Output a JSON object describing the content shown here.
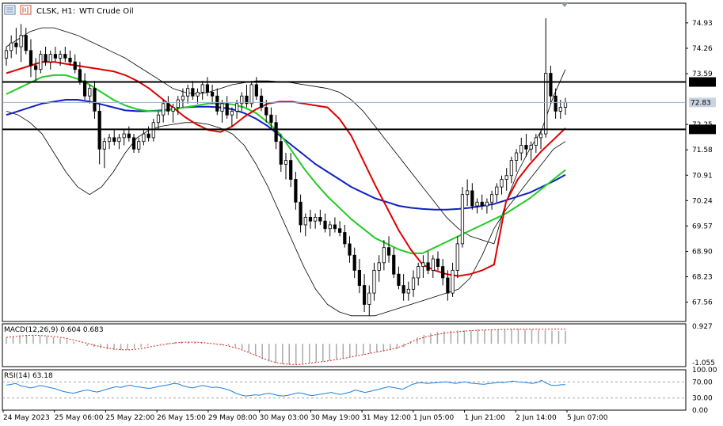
{
  "header": {
    "symbol": "CLSK, H1: ",
    "name": "WTI Crude Oil",
    "icons": [
      "list-icon",
      "chart-icon"
    ]
  },
  "colors": {
    "background": "#ffffff",
    "candle_bull": "#ffffff",
    "candle_bear": "#000000",
    "ema_red": "#e00000",
    "ema_green": "#22cc22",
    "ema_blue": "#1020c0",
    "bollinger": "#000000",
    "level_line": "#000000",
    "current_line": "#9ab0c8",
    "macd_signal": "#cc2020",
    "macd_hist": "#aaaaaa",
    "rsi_line": "#2080e0"
  },
  "chart_data": [
    {
      "type": "candlestick",
      "title": "CLSK, H1:  WTI Crude Oil",
      "ylim": [
        67.05,
        75.45
      ],
      "y_ticks": [
        "74.93",
        "74.26",
        "73.59",
        "72.25",
        "71.58",
        "70.91",
        "70.24",
        "69.57",
        "68.90",
        "68.23",
        "67.56"
      ],
      "price_labels": [
        {
          "text": "73.37",
          "value": 73.37,
          "kind": "level"
        },
        {
          "text": "72.83",
          "value": 72.83,
          "kind": "current"
        },
        {
          "text": "72.12",
          "value": 72.12,
          "kind": "level"
        }
      ],
      "horizontal_lines": [
        73.37,
        72.12
      ],
      "current_price": 72.83,
      "x_labels": [
        "24 May 2023",
        "25 May 06:00",
        "25 May 22:00",
        "26 May 15:00",
        "29 May 08:00",
        "30 May 03:00",
        "30 May 19:00",
        "31 May 12:00",
        "1 Jun 05:00",
        "1 Jun 21:00",
        "2 Jun 14:00",
        "5 Jun 07:00"
      ],
      "candles": [
        [
          74.0,
          74.3,
          73.8,
          74.2
        ],
        [
          74.2,
          74.6,
          74.0,
          74.4
        ],
        [
          74.4,
          74.8,
          74.1,
          74.3
        ],
        [
          74.3,
          74.9,
          73.9,
          74.6
        ],
        [
          74.6,
          74.8,
          74.1,
          74.2
        ],
        [
          74.2,
          74.5,
          73.5,
          73.8
        ],
        [
          73.8,
          74.0,
          73.4,
          73.7
        ],
        [
          73.7,
          74.2,
          73.6,
          74.1
        ],
        [
          74.1,
          74.3,
          73.8,
          73.9
        ],
        [
          73.9,
          74.2,
          73.7,
          74.1
        ],
        [
          74.1,
          74.3,
          73.9,
          74.0
        ],
        [
          74.0,
          74.2,
          73.8,
          74.1
        ],
        [
          74.1,
          74.3,
          73.9,
          74.0
        ],
        [
          74.0,
          74.2,
          73.8,
          73.9
        ],
        [
          73.9,
          74.1,
          73.6,
          73.7
        ],
        [
          73.7,
          73.9,
          73.3,
          73.4
        ],
        [
          73.4,
          73.6,
          72.9,
          73.0
        ],
        [
          73.0,
          73.3,
          72.8,
          73.2
        ],
        [
          73.2,
          73.4,
          72.4,
          72.6
        ],
        [
          72.6,
          72.8,
          71.2,
          71.6
        ],
        [
          71.6,
          71.9,
          71.1,
          71.8
        ],
        [
          71.8,
          72.0,
          71.6,
          71.9
        ],
        [
          71.9,
          72.1,
          71.7,
          71.8
        ],
        [
          71.8,
          72.0,
          71.6,
          71.9
        ],
        [
          71.9,
          72.1,
          71.7,
          72.0
        ],
        [
          72.0,
          72.2,
          71.8,
          71.9
        ],
        [
          71.9,
          72.0,
          71.5,
          71.6
        ],
        [
          71.6,
          71.9,
          71.5,
          71.8
        ],
        [
          71.8,
          72.1,
          71.7,
          72.0
        ],
        [
          72.0,
          72.2,
          71.8,
          71.9
        ],
        [
          71.9,
          72.4,
          71.8,
          72.3
        ],
        [
          72.3,
          72.6,
          72.1,
          72.5
        ],
        [
          72.5,
          72.9,
          72.3,
          72.8
        ],
        [
          72.8,
          73.0,
          72.5,
          72.6
        ],
        [
          72.6,
          72.8,
          72.3,
          72.7
        ],
        [
          72.7,
          73.0,
          72.5,
          72.9
        ],
        [
          72.9,
          73.2,
          72.7,
          73.0
        ],
        [
          73.0,
          73.3,
          72.8,
          73.2
        ],
        [
          73.2,
          73.4,
          72.9,
          73.0
        ],
        [
          73.0,
          73.2,
          72.8,
          73.1
        ],
        [
          73.1,
          73.4,
          72.9,
          73.3
        ],
        [
          73.3,
          73.5,
          73.0,
          73.1
        ],
        [
          73.1,
          73.3,
          72.8,
          73.0
        ],
        [
          73.0,
          73.2,
          72.5,
          72.6
        ],
        [
          72.6,
          72.9,
          72.3,
          72.8
        ],
        [
          72.8,
          73.0,
          72.4,
          72.5
        ],
        [
          72.5,
          72.7,
          72.2,
          72.6
        ],
        [
          72.6,
          72.9,
          72.4,
          72.8
        ],
        [
          72.8,
          73.1,
          72.6,
          73.0
        ],
        [
          73.0,
          73.3,
          72.7,
          72.8
        ],
        [
          72.8,
          73.4,
          72.7,
          73.3
        ],
        [
          73.3,
          73.5,
          72.9,
          73.0
        ],
        [
          73.0,
          73.2,
          72.6,
          72.7
        ],
        [
          72.7,
          72.9,
          72.3,
          72.5
        ],
        [
          72.5,
          72.7,
          72.1,
          72.3
        ],
        [
          72.3,
          72.5,
          71.6,
          71.8
        ],
        [
          71.8,
          72.0,
          71.0,
          71.2
        ],
        [
          71.2,
          71.5,
          70.8,
          71.3
        ],
        [
          71.3,
          71.5,
          70.6,
          70.8
        ],
        [
          70.8,
          71.0,
          70.0,
          70.2
        ],
        [
          70.2,
          70.4,
          69.4,
          69.6
        ],
        [
          69.6,
          69.9,
          69.3,
          69.8
        ],
        [
          69.8,
          70.0,
          69.5,
          69.7
        ],
        [
          69.7,
          69.9,
          69.5,
          69.8
        ],
        [
          69.8,
          70.0,
          69.6,
          69.7
        ],
        [
          69.7,
          69.9,
          69.4,
          69.5
        ],
        [
          69.5,
          69.7,
          69.3,
          69.6
        ],
        [
          69.6,
          69.8,
          69.4,
          69.5
        ],
        [
          69.5,
          69.7,
          69.3,
          69.4
        ],
        [
          69.4,
          69.6,
          69.0,
          69.1
        ],
        [
          69.1,
          69.3,
          68.6,
          68.8
        ],
        [
          68.8,
          69.0,
          68.2,
          68.4
        ],
        [
          68.4,
          68.7,
          67.8,
          68.0
        ],
        [
          68.0,
          68.3,
          67.3,
          67.5
        ],
        [
          67.5,
          68.0,
          67.2,
          67.8
        ],
        [
          67.8,
          68.6,
          67.6,
          68.4
        ],
        [
          68.4,
          68.8,
          68.1,
          68.6
        ],
        [
          68.6,
          69.2,
          68.4,
          69.0
        ],
        [
          69.0,
          69.3,
          68.6,
          68.8
        ],
        [
          68.8,
          69.0,
          68.2,
          68.3
        ],
        [
          68.3,
          68.5,
          67.9,
          68.0
        ],
        [
          68.0,
          68.3,
          67.6,
          67.8
        ],
        [
          67.8,
          68.1,
          67.6,
          67.9
        ],
        [
          67.9,
          68.4,
          67.7,
          68.2
        ],
        [
          68.2,
          68.6,
          68.0,
          68.5
        ],
        [
          68.5,
          68.8,
          68.2,
          68.6
        ],
        [
          68.6,
          68.9,
          68.3,
          68.4
        ],
        [
          68.4,
          68.8,
          68.2,
          68.7
        ],
        [
          68.7,
          68.9,
          68.4,
          68.5
        ],
        [
          68.5,
          68.7,
          68.0,
          68.2
        ],
        [
          68.2,
          68.4,
          67.6,
          67.8
        ],
        [
          67.8,
          68.6,
          67.7,
          68.4
        ],
        [
          68.4,
          69.3,
          68.2,
          69.1
        ],
        [
          69.1,
          70.6,
          69.0,
          70.4
        ],
        [
          70.4,
          70.8,
          70.1,
          70.5
        ],
        [
          70.5,
          70.7,
          70.0,
          70.1
        ],
        [
          70.1,
          70.3,
          69.9,
          70.2
        ],
        [
          70.2,
          70.4,
          70.0,
          70.1
        ],
        [
          70.1,
          70.3,
          69.9,
          70.2
        ],
        [
          70.2,
          70.5,
          70.0,
          70.4
        ],
        [
          70.4,
          70.7,
          70.2,
          70.6
        ],
        [
          70.6,
          70.9,
          70.4,
          70.8
        ],
        [
          70.8,
          71.1,
          70.5,
          70.9
        ],
        [
          70.9,
          71.4,
          70.7,
          71.3
        ],
        [
          71.3,
          71.6,
          71.0,
          71.5
        ],
        [
          71.5,
          71.9,
          71.3,
          71.7
        ],
        [
          71.7,
          72.0,
          71.4,
          71.6
        ],
        [
          71.6,
          71.8,
          71.3,
          71.7
        ],
        [
          71.7,
          72.0,
          71.5,
          71.9
        ],
        [
          71.9,
          72.1,
          71.6,
          72.0
        ],
        [
          72.0,
          75.05,
          71.9,
          73.6
        ],
        [
          73.6,
          73.8,
          72.8,
          73.0
        ],
        [
          73.0,
          73.2,
          72.4,
          72.6
        ],
        [
          72.6,
          72.9,
          72.4,
          72.7
        ],
        [
          72.7,
          72.95,
          72.5,
          72.83
        ]
      ],
      "ema_red": [
        73.6,
        73.7,
        73.8,
        73.9,
        73.9,
        73.85,
        73.8,
        73.75,
        73.7,
        73.65,
        73.55,
        73.4,
        73.2,
        72.95,
        72.7,
        72.45,
        72.25,
        72.1,
        72.05,
        72.2,
        72.45,
        72.65,
        72.8,
        72.85,
        72.85,
        72.8,
        72.75,
        72.7,
        72.4,
        71.95,
        71.3,
        70.65,
        70.05,
        69.45,
        68.95,
        68.55,
        68.4,
        68.3,
        68.25,
        68.3,
        68.4,
        68.55,
        70.2,
        70.8,
        71.2,
        71.55,
        71.85,
        72.15
      ],
      "ema_green": [
        73.05,
        73.2,
        73.35,
        73.5,
        73.55,
        73.55,
        73.45,
        73.3,
        73.1,
        72.9,
        72.75,
        72.65,
        72.6,
        72.6,
        72.65,
        72.7,
        72.75,
        72.8,
        72.8,
        72.78,
        72.7,
        72.55,
        72.3,
        72.0,
        71.55,
        71.1,
        70.7,
        70.35,
        70.05,
        69.75,
        69.5,
        69.25,
        69.1,
        68.95,
        68.85,
        68.85,
        69.0,
        69.15,
        69.3,
        69.45,
        69.6,
        69.75,
        69.9,
        70.1,
        70.3,
        70.55,
        70.8,
        71.05
      ],
      "ema_blue": [
        72.5,
        72.6,
        72.7,
        72.8,
        72.85,
        72.9,
        72.9,
        72.85,
        72.78,
        72.7,
        72.62,
        72.6,
        72.6,
        72.62,
        72.65,
        72.7,
        72.72,
        72.72,
        72.7,
        72.65,
        72.55,
        72.4,
        72.2,
        71.95,
        71.7,
        71.45,
        71.2,
        71.0,
        70.8,
        70.6,
        70.45,
        70.3,
        70.2,
        70.1,
        70.05,
        70.02,
        70.0,
        70.0,
        70.02,
        70.05,
        70.1,
        70.15,
        70.25,
        70.35,
        70.45,
        70.6,
        70.75,
        70.92
      ],
      "bb_upper": [
        74.3,
        74.5,
        74.7,
        74.8,
        74.8,
        74.7,
        74.6,
        74.45,
        74.3,
        74.15,
        74.0,
        73.8,
        73.6,
        73.4,
        73.2,
        73.1,
        73.05,
        73.1,
        73.2,
        73.3,
        73.35,
        73.4,
        73.4,
        73.38,
        73.35,
        73.3,
        73.25,
        73.2,
        73.1,
        72.9,
        72.6,
        72.2,
        71.8,
        71.4,
        71.0,
        70.6,
        70.2,
        69.8,
        69.5,
        69.3,
        69.2,
        69.1,
        70.2,
        71.0,
        71.6,
        72.1,
        73.0,
        73.7
      ],
      "bb_lower": [
        72.6,
        72.5,
        72.3,
        72.0,
        71.5,
        71.0,
        70.6,
        70.4,
        70.6,
        71.0,
        71.5,
        71.9,
        72.1,
        72.2,
        72.25,
        72.3,
        72.3,
        72.25,
        72.15,
        72.0,
        71.7,
        71.2,
        70.6,
        69.9,
        69.2,
        68.5,
        67.9,
        67.5,
        67.3,
        67.2,
        67.2,
        67.2,
        67.3,
        67.4,
        67.5,
        67.6,
        67.7,
        67.8,
        67.9,
        68.2,
        68.8,
        69.5,
        70.0,
        70.4,
        70.8,
        71.2,
        71.6,
        71.8
      ],
      "band_mid_hint": "bollinger bands drawn as thin black envelope"
    },
    {
      "type": "bar",
      "title": "MACD(12,26,9) 0.604 0.683",
      "ylim": [
        -1.055,
        0.927
      ],
      "y_ticks": [
        "0.927",
        "-1.055"
      ],
      "histogram": [
        0.3,
        0.35,
        0.4,
        0.42,
        0.4,
        0.38,
        0.35,
        0.3,
        0.25,
        0.2,
        0.1,
        0.0,
        -0.1,
        -0.15,
        -0.2,
        -0.25,
        -0.28,
        -0.3,
        -0.28,
        -0.22,
        -0.15,
        -0.08,
        -0.02,
        0.02,
        0.05,
        0.08,
        0.1,
        0.1,
        0.08,
        0.05,
        0.02,
        -0.02,
        -0.05,
        -0.08,
        -0.15,
        -0.25,
        -0.4,
        -0.55,
        -0.7,
        -0.82,
        -0.9,
        -0.95,
        -0.97,
        -0.95,
        -0.92,
        -0.88,
        -0.85,
        -0.82,
        -0.78,
        -0.72,
        -0.66,
        -0.6,
        -0.55,
        -0.5,
        -0.45,
        -0.4,
        -0.35,
        -0.3,
        -0.25,
        -0.15,
        0.1,
        0.3,
        0.42,
        0.5,
        0.55,
        0.58,
        0.6,
        0.62,
        0.63,
        0.64,
        0.65,
        0.66,
        0.66,
        0.67,
        0.68,
        0.69,
        0.69,
        0.68,
        0.67,
        0.65,
        0.63,
        0.61,
        0.6,
        0.6
      ],
      "signal": [
        0.3,
        0.33,
        0.36,
        0.39,
        0.4,
        0.39,
        0.37,
        0.34,
        0.3,
        0.25,
        0.18,
        0.1,
        0.02,
        -0.06,
        -0.13,
        -0.19,
        -0.24,
        -0.27,
        -0.28,
        -0.26,
        -0.22,
        -0.16,
        -0.1,
        -0.05,
        0.0,
        0.04,
        0.07,
        0.08,
        0.08,
        0.06,
        0.03,
        0.0,
        -0.04,
        -0.1,
        -0.18,
        -0.28,
        -0.4,
        -0.53,
        -0.66,
        -0.77,
        -0.86,
        -0.92,
        -0.95,
        -0.96,
        -0.94,
        -0.9,
        -0.86,
        -0.82,
        -0.78,
        -0.73,
        -0.68,
        -0.62,
        -0.56,
        -0.5,
        -0.44,
        -0.38,
        -0.32,
        -0.26,
        -0.18,
        -0.08,
        0.08,
        0.2,
        0.3,
        0.38,
        0.44,
        0.49,
        0.53,
        0.56,
        0.59,
        0.61,
        0.63,
        0.64,
        0.65,
        0.66,
        0.67,
        0.68,
        0.68,
        0.68,
        0.68,
        0.68,
        0.68,
        0.68,
        0.683,
        0.683
      ]
    },
    {
      "type": "line",
      "title": "RSI(14) 63.18",
      "ylim": [
        0,
        100
      ],
      "y_ticks": [
        "100.00",
        "70.00",
        "30.00",
        "0.00"
      ],
      "levels": [
        70,
        30
      ],
      "values": [
        62,
        64,
        66,
        60,
        58,
        55,
        57,
        61,
        59,
        56,
        54,
        50,
        46,
        44,
        42,
        45,
        48,
        50,
        47,
        45,
        48,
        52,
        55,
        58,
        56,
        60,
        62,
        58,
        57,
        55,
        54,
        56,
        59,
        61,
        63,
        66,
        65,
        60,
        57,
        55,
        58,
        61,
        59,
        56,
        57,
        55,
        52,
        48,
        42,
        38,
        35,
        36,
        38,
        37,
        40,
        42,
        39,
        36,
        35,
        37,
        40,
        43,
        42,
        38,
        36,
        38,
        40,
        42,
        44,
        41,
        39,
        42,
        45,
        50,
        47,
        44,
        46,
        49,
        52,
        55,
        58,
        56,
        54,
        52,
        58,
        64,
        67,
        68,
        66,
        67,
        68,
        69,
        70,
        68,
        66,
        68,
        70,
        67,
        66,
        65,
        64,
        66,
        67,
        69,
        68,
        70,
        72,
        70,
        69,
        68,
        66,
        68,
        74,
        67,
        62,
        61,
        63,
        63.18
      ]
    }
  ]
}
